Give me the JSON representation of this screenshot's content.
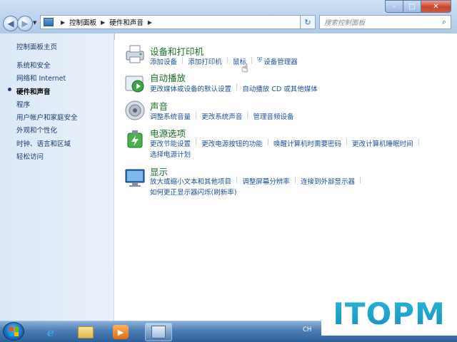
{
  "window": {
    "min": "–",
    "max": "□",
    "close": "✕"
  },
  "nav": {
    "back": "◀",
    "forward": "▶"
  },
  "address": {
    "path": [
      "控制面板",
      "硬件和声音"
    ]
  },
  "search": {
    "placeholder": "搜索控制面板"
  },
  "sidebar": {
    "items": [
      {
        "label": "控制面板主页"
      },
      {
        "label": "系统和安全"
      },
      {
        "label": "网络和 Internet"
      },
      {
        "label": "硬件和声音"
      },
      {
        "label": "程序"
      },
      {
        "label": "用户帐户和家庭安全"
      },
      {
        "label": "外观和个性化"
      },
      {
        "label": "时钟、语言和区域"
      },
      {
        "label": "轻松访问"
      }
    ]
  },
  "categories": [
    {
      "title": "设备和打印机",
      "icon": "printer-icon",
      "links": [
        "添加设备",
        "添加打印机",
        "鼠标",
        "设备管理器"
      ]
    },
    {
      "title": "自动播放",
      "icon": "autoplay-icon",
      "links": [
        "更改媒体或设备的默认设置",
        "自动播放 CD 或其他媒体"
      ]
    },
    {
      "title": "声音",
      "icon": "speaker-icon",
      "links": [
        "调整系统音量",
        "更改系统声音",
        "管理音频设备"
      ]
    },
    {
      "title": "电源选项",
      "icon": "battery-icon",
      "links": [
        "更改节能设置",
        "更改电源按钮的功能",
        "唤醒计算机时需要密码",
        "更改计算机睡眠时间"
      ],
      "links2": [
        "选择电源计划"
      ]
    },
    {
      "title": "显示",
      "icon": "display-icon",
      "links": [
        "放大或缩小文本和其他项目",
        "调整屏幕分辨率",
        "连接到外部显示器"
      ],
      "links2": [
        "如何更正显示器闪烁(刷新率)"
      ]
    }
  ],
  "taskbar": {
    "lang": "CH"
  },
  "watermark": {
    "text": "ITOPM"
  },
  "colors": {
    "link": "#1c4f9c",
    "category_title": "#1e6d2a",
    "watermark": "#1a8fc4"
  }
}
